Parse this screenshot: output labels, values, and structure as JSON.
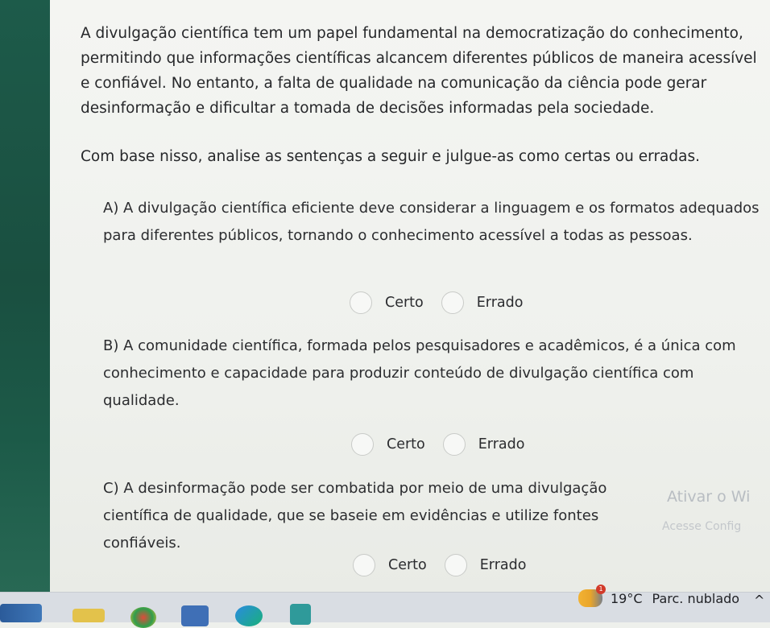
{
  "intro": "A divulgação científica tem um papel fundamental na democratização do conhecimento, permitindo que informações científicas alcancem diferentes públicos de maneira acessível e confiável. No entanto, a falta de qualidade na comunicação da ciência pode gerar desinformação e dificultar a tomada de decisões informadas pela sociedade.",
  "instruction": "Com base nisso, analise as sentenças a seguir e julgue-as como certas ou erradas.",
  "questions": [
    {
      "text": "A) A divulgação científica eficiente deve considerar a linguagem e os formatos adequados para diferentes públicos, tornando o conhecimento acessível a todas as pessoas.",
      "option_true": "Certo",
      "option_false": "Errado"
    },
    {
      "text": "B) A comunidade científica, formada pelos pesquisadores e acadêmicos, é a única com conhecimento e capacidade para produzir conteúdo de divulgação científica com qualidade.",
      "option_true": "Certo",
      "option_false": "Errado"
    },
    {
      "text": "C) A desinformação pode ser combatida por meio de uma divulgação científica de qualidade, que se baseie em evidências e utilize fontes confiáveis.",
      "option_true": "Certo",
      "option_false": "Errado"
    }
  ],
  "watermark": {
    "line1": "Ativar o Wi",
    "line2": "Acesse Config"
  },
  "taskbar": {
    "weather_icon": "partly-cloudy-icon",
    "badge": "1",
    "temperature": "19°C",
    "condition": "Parc. nublado",
    "chevron": "^"
  }
}
